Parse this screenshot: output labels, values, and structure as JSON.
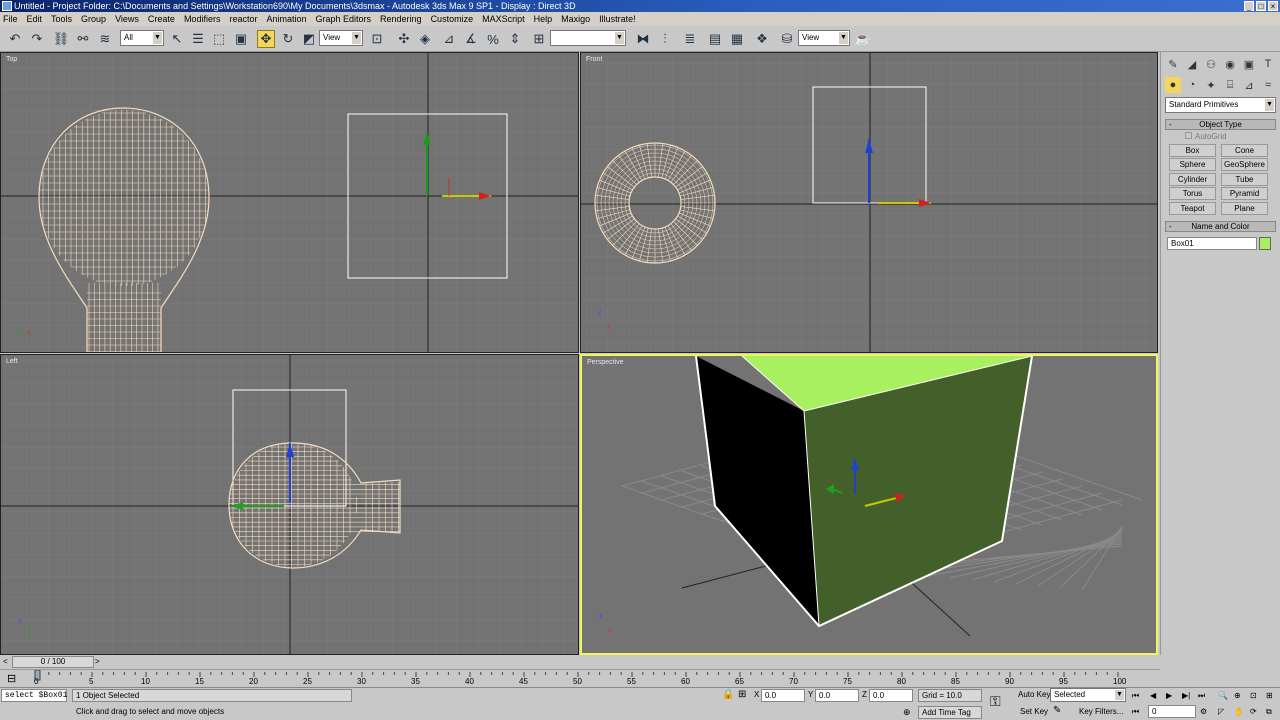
{
  "title_bar": {
    "text": "Untitled    - Project Folder: C:\\Documents and Settings\\Workstation690\\My Documents\\3dsmax    - Autodesk 3ds Max 9 SP1    - Display : Direct 3D"
  },
  "menu": [
    "File",
    "Edit",
    "Tools",
    "Group",
    "Views",
    "Create",
    "Modifiers",
    "reactor",
    "Animation",
    "Graph Editors",
    "Rendering",
    "Customize",
    "MAXScript",
    "Help",
    "Maxigo",
    "Illustrate!"
  ],
  "toolbar": {
    "selection_filter": "All",
    "reference_coord": "View",
    "reference_coord2": "View",
    "named_selection": "",
    "active_tool": "select-and-move"
  },
  "viewports": {
    "top": "Top",
    "front": "Front",
    "left": "Left",
    "perspective": "Perspective",
    "active": "perspective"
  },
  "command_panel": {
    "category_dropdown": "Standard Primitives",
    "object_type_title": "Object Type",
    "autogrid_label": "AutoGrid",
    "buttons": [
      "Box",
      "Cone",
      "Sphere",
      "GeoSphere",
      "Cylinder",
      "Tube",
      "Torus",
      "Pyramid",
      "Teapot",
      "Plane"
    ],
    "name_color_title": "Name and Color",
    "object_name": "Box01",
    "object_color": "#a8f060"
  },
  "timeline": {
    "frame_display": "0 / 100",
    "ticks": [
      "0",
      "5",
      "10",
      "15",
      "20",
      "25",
      "30",
      "35",
      "40",
      "45",
      "50",
      "55",
      "60",
      "65",
      "70",
      "75",
      "80",
      "85",
      "90",
      "95",
      "100"
    ]
  },
  "status": {
    "maxscript_listener": "select $Box01",
    "selection_count": "1 Object Selected",
    "prompt": "Click and drag to select and move objects",
    "x_label": "X",
    "x_value": "0.0",
    "y_label": "Y",
    "y_value": "0.0",
    "z_label": "Z",
    "z_value": "0.0",
    "grid": "Grid = 10.0",
    "add_time_tag": "Add Time Tag",
    "auto_key": "Auto Key",
    "set_key": "Set Key",
    "key_mode": "Selected",
    "key_filters": "Key Filters...",
    "current_frame": "0"
  },
  "colors": {
    "viewport_bg": "#737373",
    "wireframe": "#f5dcc0",
    "box_green": "#a8f060",
    "active_border": "#f6f25a"
  }
}
